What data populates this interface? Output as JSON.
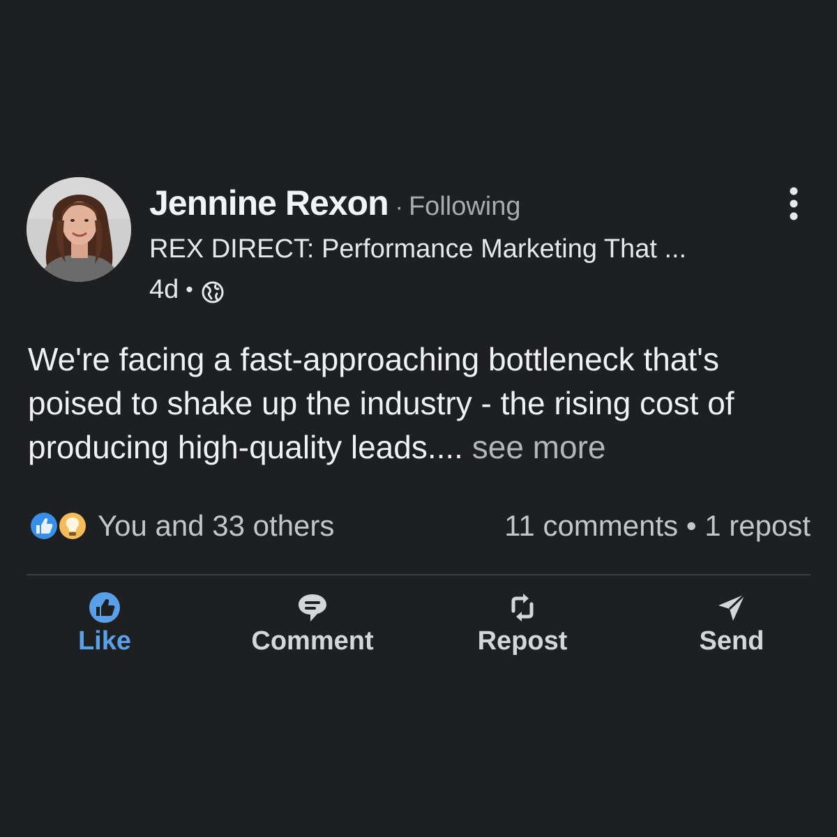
{
  "post": {
    "author": {
      "name": "Jennine Rexon",
      "separator": "·",
      "relationship": "Following",
      "headline": "REX DIRECT: Performance Marketing That ...",
      "timestamp": "4d",
      "meta_separator": "•",
      "visibility_icon": "globe-icon"
    },
    "body": {
      "text": "We're facing a fast-approaching bottleneck that's poised to shake up the industry - the rising cost of producing high-quality leads....",
      "see_more": "see more"
    },
    "social": {
      "reaction_icons": [
        "like-reaction-icon",
        "insightful-reaction-icon"
      ],
      "reactors": "You and 33 others",
      "comments": "11 comments",
      "separator": "•",
      "reposts": "1 repost"
    },
    "actions": {
      "like": "Like",
      "comment": "Comment",
      "repost": "Repost",
      "send": "Send"
    },
    "colors": {
      "background": "#1d1f21",
      "like_active": "#5aa0e8",
      "insightful": "#f5bb5c"
    }
  }
}
